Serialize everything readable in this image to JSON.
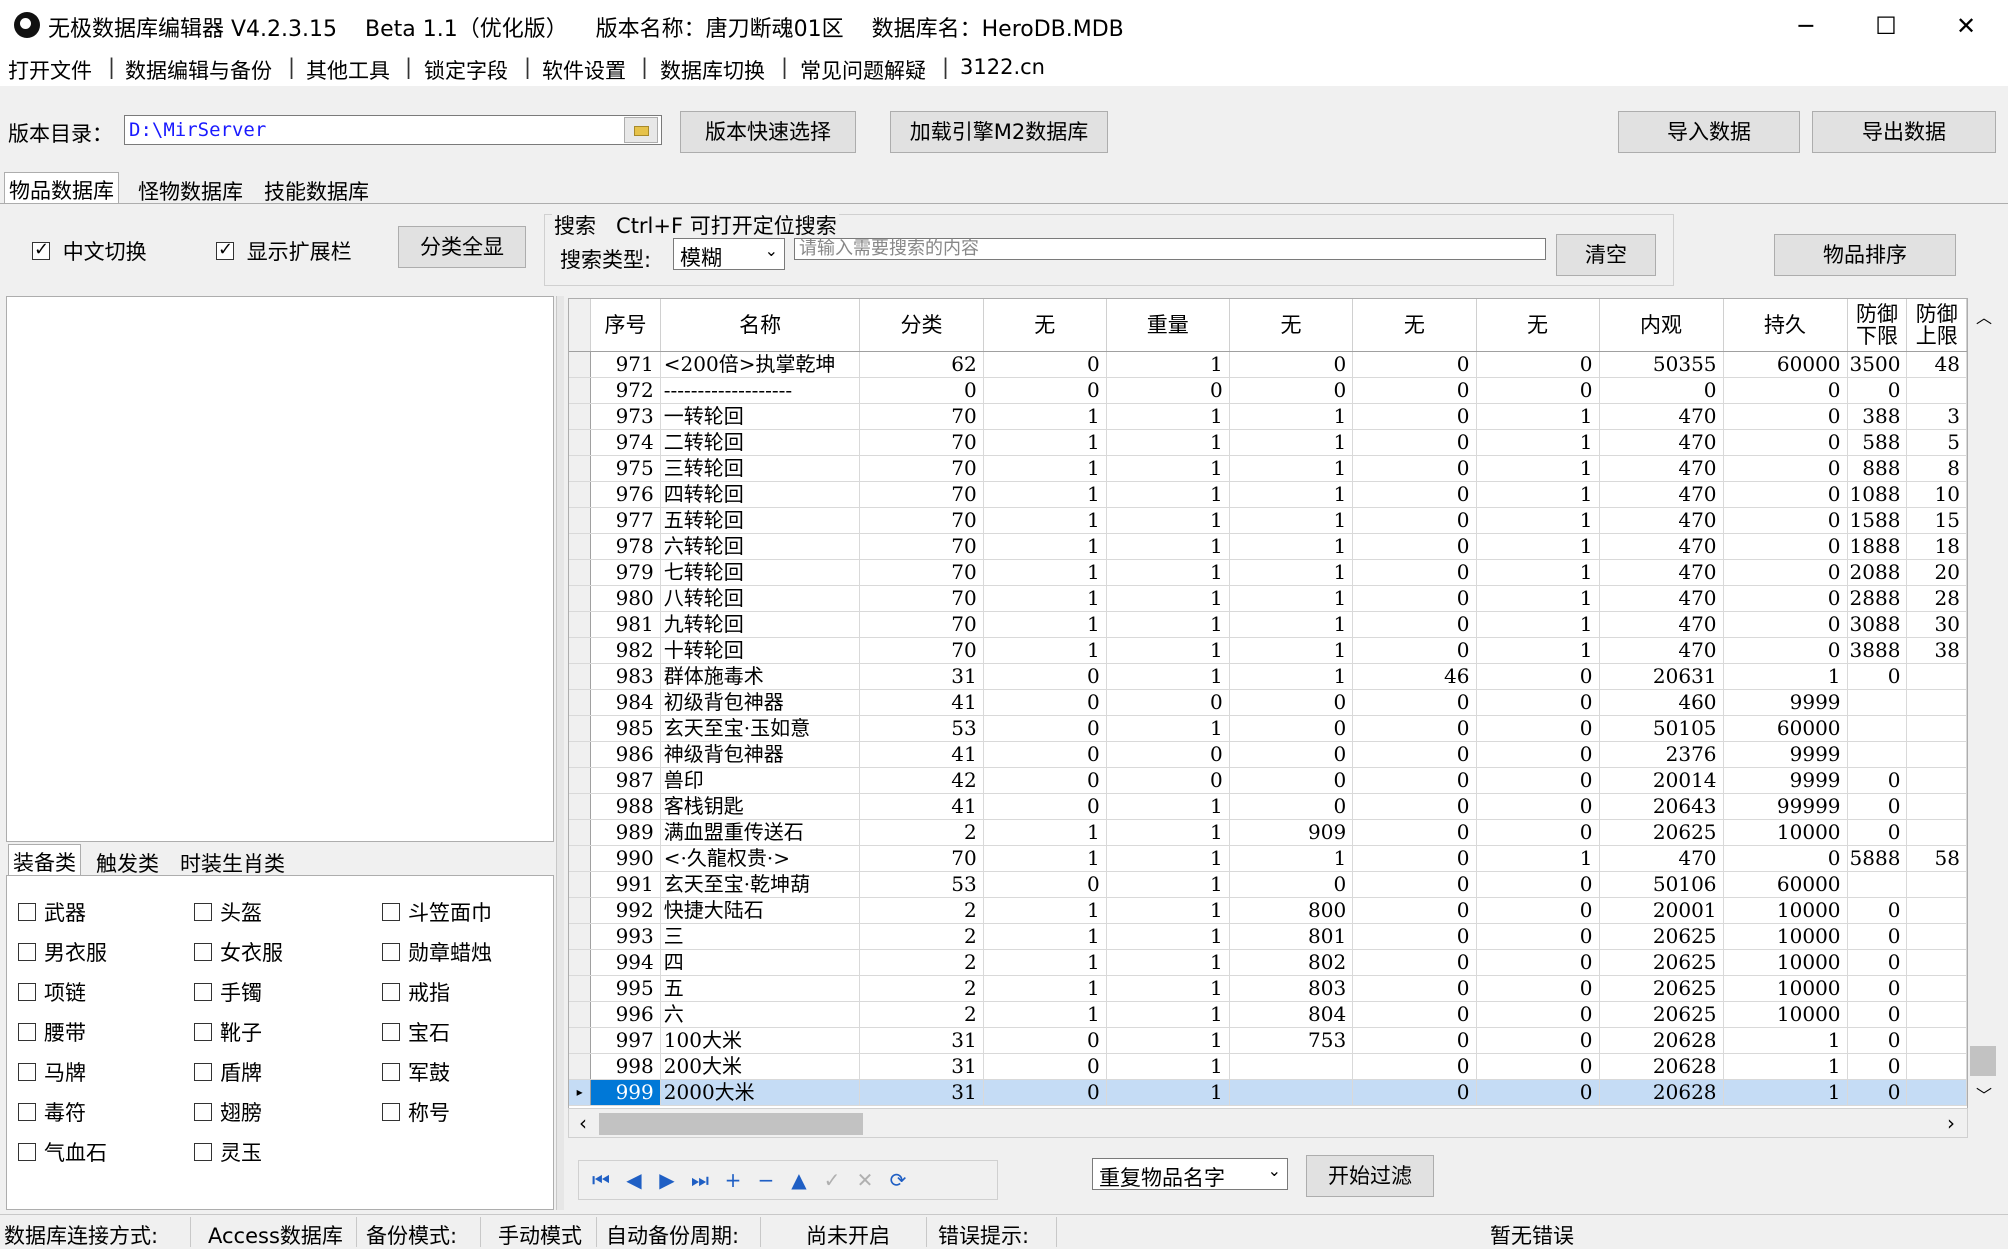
{
  "window": {
    "title": "无极数据库编辑器 V4.2.3.15    Beta 1.1（优化版）    版本名称：唐刀断魂01区    数据库名：HeroDB.MDB",
    "minimize": "─",
    "maximize": "☐",
    "close": "✕"
  },
  "menu": [
    "打开文件",
    "数据编辑与备份",
    "其他工具",
    "锁定字段",
    "软件设置",
    "数据库切换",
    "常见问题解疑",
    "3122.cn"
  ],
  "toolbar": {
    "version_dir_label": "版本目录：",
    "version_dir_value": "D:\\MirServer",
    "quick_select": "版本快速选择",
    "load_m2": "加载引擎M2数据库",
    "import": "导入数据",
    "export": "导出数据"
  },
  "tabs": [
    "物品数据库",
    "怪物数据库",
    "技能数据库"
  ],
  "options": {
    "chinese_switch": "中文切换",
    "show_ext": "显示扩展栏",
    "show_all": "分类全显",
    "search_title": "搜索   Ctrl+F 可打开定位搜索",
    "search_type_label": "搜索类型:",
    "search_type_value": "模糊",
    "search_placeholder": "请输入需要搜索的内容",
    "clear": "清空",
    "sort": "物品排序"
  },
  "category_tabs": [
    "装备类",
    "触发类",
    "时装生肖类"
  ],
  "categories": [
    "武器",
    "头盔",
    "斗笠面巾",
    "男衣服",
    "女衣服",
    "勋章蜡烛",
    "项链",
    "手镯",
    "戒指",
    "腰带",
    "靴子",
    "宝石",
    "马牌",
    "盾牌",
    "军鼓",
    "毒符",
    "翅膀",
    "称号",
    "气血石",
    "灵玉"
  ],
  "grid": {
    "headers": [
      "序号",
      "名称",
      "分类",
      "无",
      "重量",
      "无",
      "无",
      "无",
      "内观",
      "持久",
      "防御\n下限",
      "防御\n上限"
    ],
    "rows": [
      [
        "971",
        "<200倍>执掌乾坤",
        "62",
        "0",
        "1",
        "0",
        "0",
        "0",
        "50355",
        "60000",
        "3500",
        "48"
      ],
      [
        "972",
        "-------------------",
        "0",
        "0",
        "0",
        "0",
        "0",
        "0",
        "0",
        "0",
        "0",
        ""
      ],
      [
        "973",
        "一转轮回",
        "70",
        "1",
        "1",
        "1",
        "0",
        "1",
        "470",
        "0",
        "388",
        "3"
      ],
      [
        "974",
        "二转轮回",
        "70",
        "1",
        "1",
        "1",
        "0",
        "1",
        "470",
        "0",
        "588",
        "5"
      ],
      [
        "975",
        "三转轮回",
        "70",
        "1",
        "1",
        "1",
        "0",
        "1",
        "470",
        "0",
        "888",
        "8"
      ],
      [
        "976",
        "四转轮回",
        "70",
        "1",
        "1",
        "1",
        "0",
        "1",
        "470",
        "0",
        "1088",
        "10"
      ],
      [
        "977",
        "五转轮回",
        "70",
        "1",
        "1",
        "1",
        "0",
        "1",
        "470",
        "0",
        "1588",
        "15"
      ],
      [
        "978",
        "六转轮回",
        "70",
        "1",
        "1",
        "1",
        "0",
        "1",
        "470",
        "0",
        "1888",
        "18"
      ],
      [
        "979",
        "七转轮回",
        "70",
        "1",
        "1",
        "1",
        "0",
        "1",
        "470",
        "0",
        "2088",
        "20"
      ],
      [
        "980",
        "八转轮回",
        "70",
        "1",
        "1",
        "1",
        "0",
        "1",
        "470",
        "0",
        "2888",
        "28"
      ],
      [
        "981",
        "九转轮回",
        "70",
        "1",
        "1",
        "1",
        "0",
        "1",
        "470",
        "0",
        "3088",
        "30"
      ],
      [
        "982",
        "十转轮回",
        "70",
        "1",
        "1",
        "1",
        "0",
        "1",
        "470",
        "0",
        "3888",
        "38"
      ],
      [
        "983",
        "群体施毒术",
        "31",
        "0",
        "1",
        "1",
        "46",
        "0",
        "20631",
        "1",
        "0",
        ""
      ],
      [
        "984",
        "初级背包神器",
        "41",
        "0",
        "0",
        "0",
        "0",
        "0",
        "460",
        "9999",
        "",
        ""
      ],
      [
        "985",
        "玄天至宝·玉如意",
        "53",
        "0",
        "1",
        "0",
        "0",
        "0",
        "50105",
        "60000",
        "",
        ""
      ],
      [
        "986",
        "神级背包神器",
        "41",
        "0",
        "0",
        "0",
        "0",
        "0",
        "2376",
        "9999",
        "",
        ""
      ],
      [
        "987",
        "兽印",
        "42",
        "0",
        "0",
        "0",
        "0",
        "0",
        "20014",
        "9999",
        "0",
        ""
      ],
      [
        "988",
        "客栈钥匙",
        "41",
        "0",
        "1",
        "0",
        "0",
        "0",
        "20643",
        "99999",
        "0",
        ""
      ],
      [
        "989",
        "满血盟重传送石",
        "2",
        "1",
        "1",
        "909",
        "0",
        "0",
        "20625",
        "10000",
        "0",
        ""
      ],
      [
        "990",
        "<·久龍权贵·>",
        "70",
        "1",
        "1",
        "1",
        "0",
        "1",
        "470",
        "0",
        "5888",
        "58"
      ],
      [
        "991",
        "玄天至宝·乾坤葫",
        "53",
        "0",
        "1",
        "0",
        "0",
        "0",
        "50106",
        "60000",
        "",
        ""
      ],
      [
        "992",
        "快捷大陆石",
        "2",
        "1",
        "1",
        "800",
        "0",
        "0",
        "20001",
        "10000",
        "0",
        ""
      ],
      [
        "993",
        "三",
        "2",
        "1",
        "1",
        "801",
        "0",
        "0",
        "20625",
        "10000",
        "0",
        ""
      ],
      [
        "994",
        "四",
        "2",
        "1",
        "1",
        "802",
        "0",
        "0",
        "20625",
        "10000",
        "0",
        ""
      ],
      [
        "995",
        "五",
        "2",
        "1",
        "1",
        "803",
        "0",
        "0",
        "20625",
        "10000",
        "0",
        ""
      ],
      [
        "996",
        "六",
        "2",
        "1",
        "1",
        "804",
        "0",
        "0",
        "20625",
        "10000",
        "0",
        ""
      ],
      [
        "997",
        "100大米",
        "31",
        "0",
        "1",
        "753",
        "0",
        "0",
        "20628",
        "1",
        "0",
        ""
      ],
      [
        "998",
        "200大米",
        "31",
        "0",
        "1",
        "",
        "0",
        "0",
        "20628",
        "1",
        "0",
        ""
      ],
      [
        "999",
        "2000大米",
        "31",
        "0",
        "1",
        "",
        "0",
        "0",
        "20628",
        "1",
        "0",
        ""
      ]
    ],
    "selected_row": "999"
  },
  "nav": {
    "icons": [
      "first-icon",
      "prev-icon",
      "next-icon",
      "last-icon",
      "add-icon",
      "delete-icon",
      "edit-icon",
      "post-icon",
      "cancel-icon",
      "refresh-icon"
    ],
    "glyphs": [
      "⏮",
      "◀",
      "▶",
      "⏭",
      "+",
      "−",
      "▲",
      "✓",
      "✕",
      "⟳"
    ],
    "filter_type": "重复物品名字",
    "start_filter": "开始过滤"
  },
  "status": {
    "conn_label": "数据库连接方式:",
    "conn_value": "Access数据库",
    "backup_label": "备份模式:",
    "backup_value": "手动模式",
    "auto_label": "自动备份周期:",
    "auto_value": "尚未开启",
    "err_label": "错误提示:",
    "err_value": "暂无错误"
  }
}
